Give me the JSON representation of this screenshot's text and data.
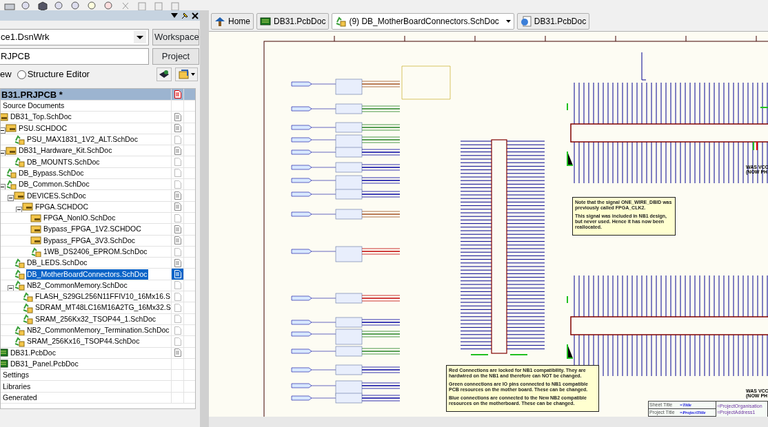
{
  "panel": {
    "workspace": {
      "value": "ce1.DsnWrk",
      "button": "Workspace"
    },
    "project": {
      "value": "RJPCB",
      "button": "Project"
    },
    "view": {
      "cut_label": "ew",
      "radio_label": "Structure Editor",
      "radio_selected": false
    },
    "tree": {
      "header": {
        "label": "B31.PRJPCB *",
        "modified": true
      },
      "items": [
        {
          "label": "Source Documents",
          "selected": false,
          "children": [
            {
              "label": "DB31_Top.SchDoc",
              "kind": "sheet",
              "open": true,
              "selected": false,
              "children": [
                {
                  "label": "PSU.SCHDOC",
                  "kind": "sheet",
                  "open": true,
                  "selected": false,
                  "expanded": true,
                  "children": [
                    {
                      "label": "PSU_MAX1831_1V2_ALT.SchDoc",
                      "kind": "recycle",
                      "open": false,
                      "selected": false
                    }
                  ]
                },
                {
                  "label": "DB31_Hardware_Kit.SchDoc",
                  "kind": "sheet",
                  "open": true,
                  "selected": false,
                  "expanded": true,
                  "children": [
                    {
                      "label": "DB_MOUNTS.SchDoc",
                      "kind": "recycle",
                      "open": false,
                      "selected": false
                    }
                  ]
                },
                {
                  "label": "DB_Bypass.SchDoc",
                  "kind": "recycle",
                  "open": false,
                  "selected": false
                },
                {
                  "label": "DB_Common.SchDoc",
                  "kind": "recycle",
                  "open": false,
                  "selected": false,
                  "expanded": true,
                  "children": [
                    {
                      "label": "DEVICES.SchDoc",
                      "kind": "sheet",
                      "open": true,
                      "selected": false,
                      "expanded": true,
                      "children": [
                        {
                          "label": "FPGA.SCHDOC",
                          "kind": "sheet",
                          "open": true,
                          "selected": false,
                          "expanded": true,
                          "children": [
                            {
                              "label": "FPGA_NonIO.SchDoc",
                              "kind": "sheet",
                              "open": false,
                              "selected": false
                            },
                            {
                              "label": "Bypass_FPGA_1V2.SCHDOC",
                              "kind": "sheet",
                              "open": true,
                              "selected": false
                            },
                            {
                              "label": "Bypass_FPGA_3V3.SchDoc",
                              "kind": "sheet",
                              "open": true,
                              "selected": false
                            },
                            {
                              "label": "1WB_DS2406_EPROM.SchDoc",
                              "kind": "recycle",
                              "open": false,
                              "selected": false
                            }
                          ]
                        }
                      ]
                    },
                    {
                      "label": "DB_LEDS.SchDoc",
                      "kind": "recycle",
                      "open": true,
                      "selected": false
                    },
                    {
                      "label": "DB_MotherBoardConnectors.SchDoc",
                      "kind": "recycle",
                      "open": true,
                      "selected": true
                    },
                    {
                      "label": "NB2_CommonMemory.SchDoc",
                      "kind": "recycle",
                      "open": false,
                      "selected": false,
                      "expanded": true,
                      "children": [
                        {
                          "label": "FLASH_S29GL256N11FFIV10_16Mx16.S",
                          "kind": "recycle",
                          "open": false,
                          "selected": false
                        },
                        {
                          "label": "SDRAM_MT48LC16M16A2TG_16Mx32.S",
                          "kind": "recycle",
                          "open": false,
                          "selected": false
                        },
                        {
                          "label": "SRAM_256Kx32_TSOP44_1.SchDoc",
                          "kind": "recycle",
                          "open": false,
                          "selected": false
                        }
                      ]
                    },
                    {
                      "label": "NB2_CommonMemory_Termination.SchDoc",
                      "kind": "recycle",
                      "open": false,
                      "selected": false
                    },
                    {
                      "label": "SRAM_256Kx16_TSOP44.SchDoc",
                      "kind": "recycle",
                      "open": false,
                      "selected": false
                    }
                  ]
                }
              ]
            },
            {
              "label": "DB31.PcbDoc",
              "kind": "pcb",
              "open": true,
              "selected": false
            },
            {
              "label": "DB31_Panel.PcbDoc",
              "kind": "pcb",
              "selected": false
            }
          ]
        },
        {
          "label": "Settings",
          "selected": false
        },
        {
          "label": "Libraries",
          "selected": false
        },
        {
          "label": "Generated",
          "selected": false
        }
      ]
    }
  },
  "tabs": [
    {
      "label": "Home",
      "kind": "home",
      "selected": false
    },
    {
      "label": "DB31.PcbDoc",
      "kind": "pcb",
      "selected": false
    },
    {
      "label": "(9) DB_MotherBoardConnectors.SchDoc",
      "kind": "recycle",
      "selected": true
    },
    {
      "label": "DB31.PcbDoc",
      "kind": "web",
      "selected": false
    }
  ],
  "schematic": {
    "notes": [
      {
        "paragraphs": [
          "Note that the signal ONE_WIRE_DBID was previously called FPGA_CLK2.",
          "This signal was included in NB1 design, but never used.  Hence it has now been reallocated."
        ]
      },
      {
        "paragraphs": [
          "Red Connections are locked for NB1 compatibility. They are hardwired on the NB1 and therefore can NOT be changed.",
          "Green connections are IO pins connected to NB1 compatible PCB resources on the mother board. These can be changed.",
          "Blue connections are connected to the New NB2 compatible resources on the motherboard. These can be changed."
        ]
      }
    ],
    "side_labels": [
      {
        "lines": [
          "WAS VCC",
          "(NOW PH"
        ]
      },
      {
        "lines": [
          "WAS VCC",
          "(NOW PH"
        ]
      }
    ],
    "title_block": {
      "rows": [
        {
          "caption": "Sheet Title",
          "value": "=Title"
        },
        {
          "caption": "Project Title",
          "value": "=ProjectTitle"
        }
      ],
      "fields": [
        "=ProjectOrganisation",
        "=ProjectAddress1"
      ]
    }
  }
}
